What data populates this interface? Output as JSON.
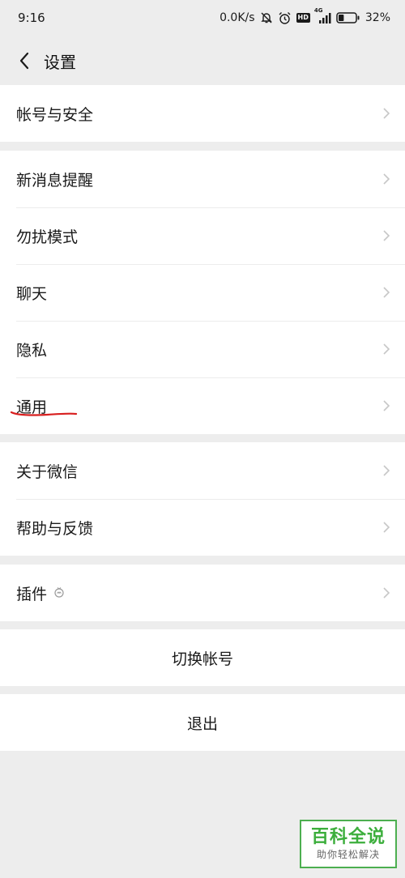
{
  "status_bar": {
    "time": "9:16",
    "net_speed": "0.0K/s",
    "network": "4G",
    "battery": "32%",
    "battery_level": 0.32,
    "icons": [
      "mute-bell-icon",
      "alarm-icon",
      "hd-icon",
      "signal-icon",
      "battery-icon"
    ],
    "hd_label": "HD"
  },
  "header": {
    "title": "设置",
    "back_icon": "back-arrow-icon"
  },
  "groups": [
    {
      "items": [
        {
          "label": "帐号与安全"
        }
      ]
    },
    {
      "items": [
        {
          "label": "新消息提醒"
        },
        {
          "label": "勿扰模式"
        },
        {
          "label": "聊天"
        },
        {
          "label": "隐私"
        },
        {
          "label": "通用"
        }
      ]
    },
    {
      "items": [
        {
          "label": "关于微信"
        },
        {
          "label": "帮助与反馈"
        }
      ]
    },
    {
      "items": [
        {
          "label": "插件"
        }
      ]
    }
  ],
  "actions": {
    "switch_account": "切换帐号",
    "logout": "退出"
  },
  "annotation": {
    "color": "#d81e1e"
  },
  "watermark": {
    "title": "百科全说",
    "subtitle": "助你轻松解决",
    "color": "#3cae3c"
  }
}
